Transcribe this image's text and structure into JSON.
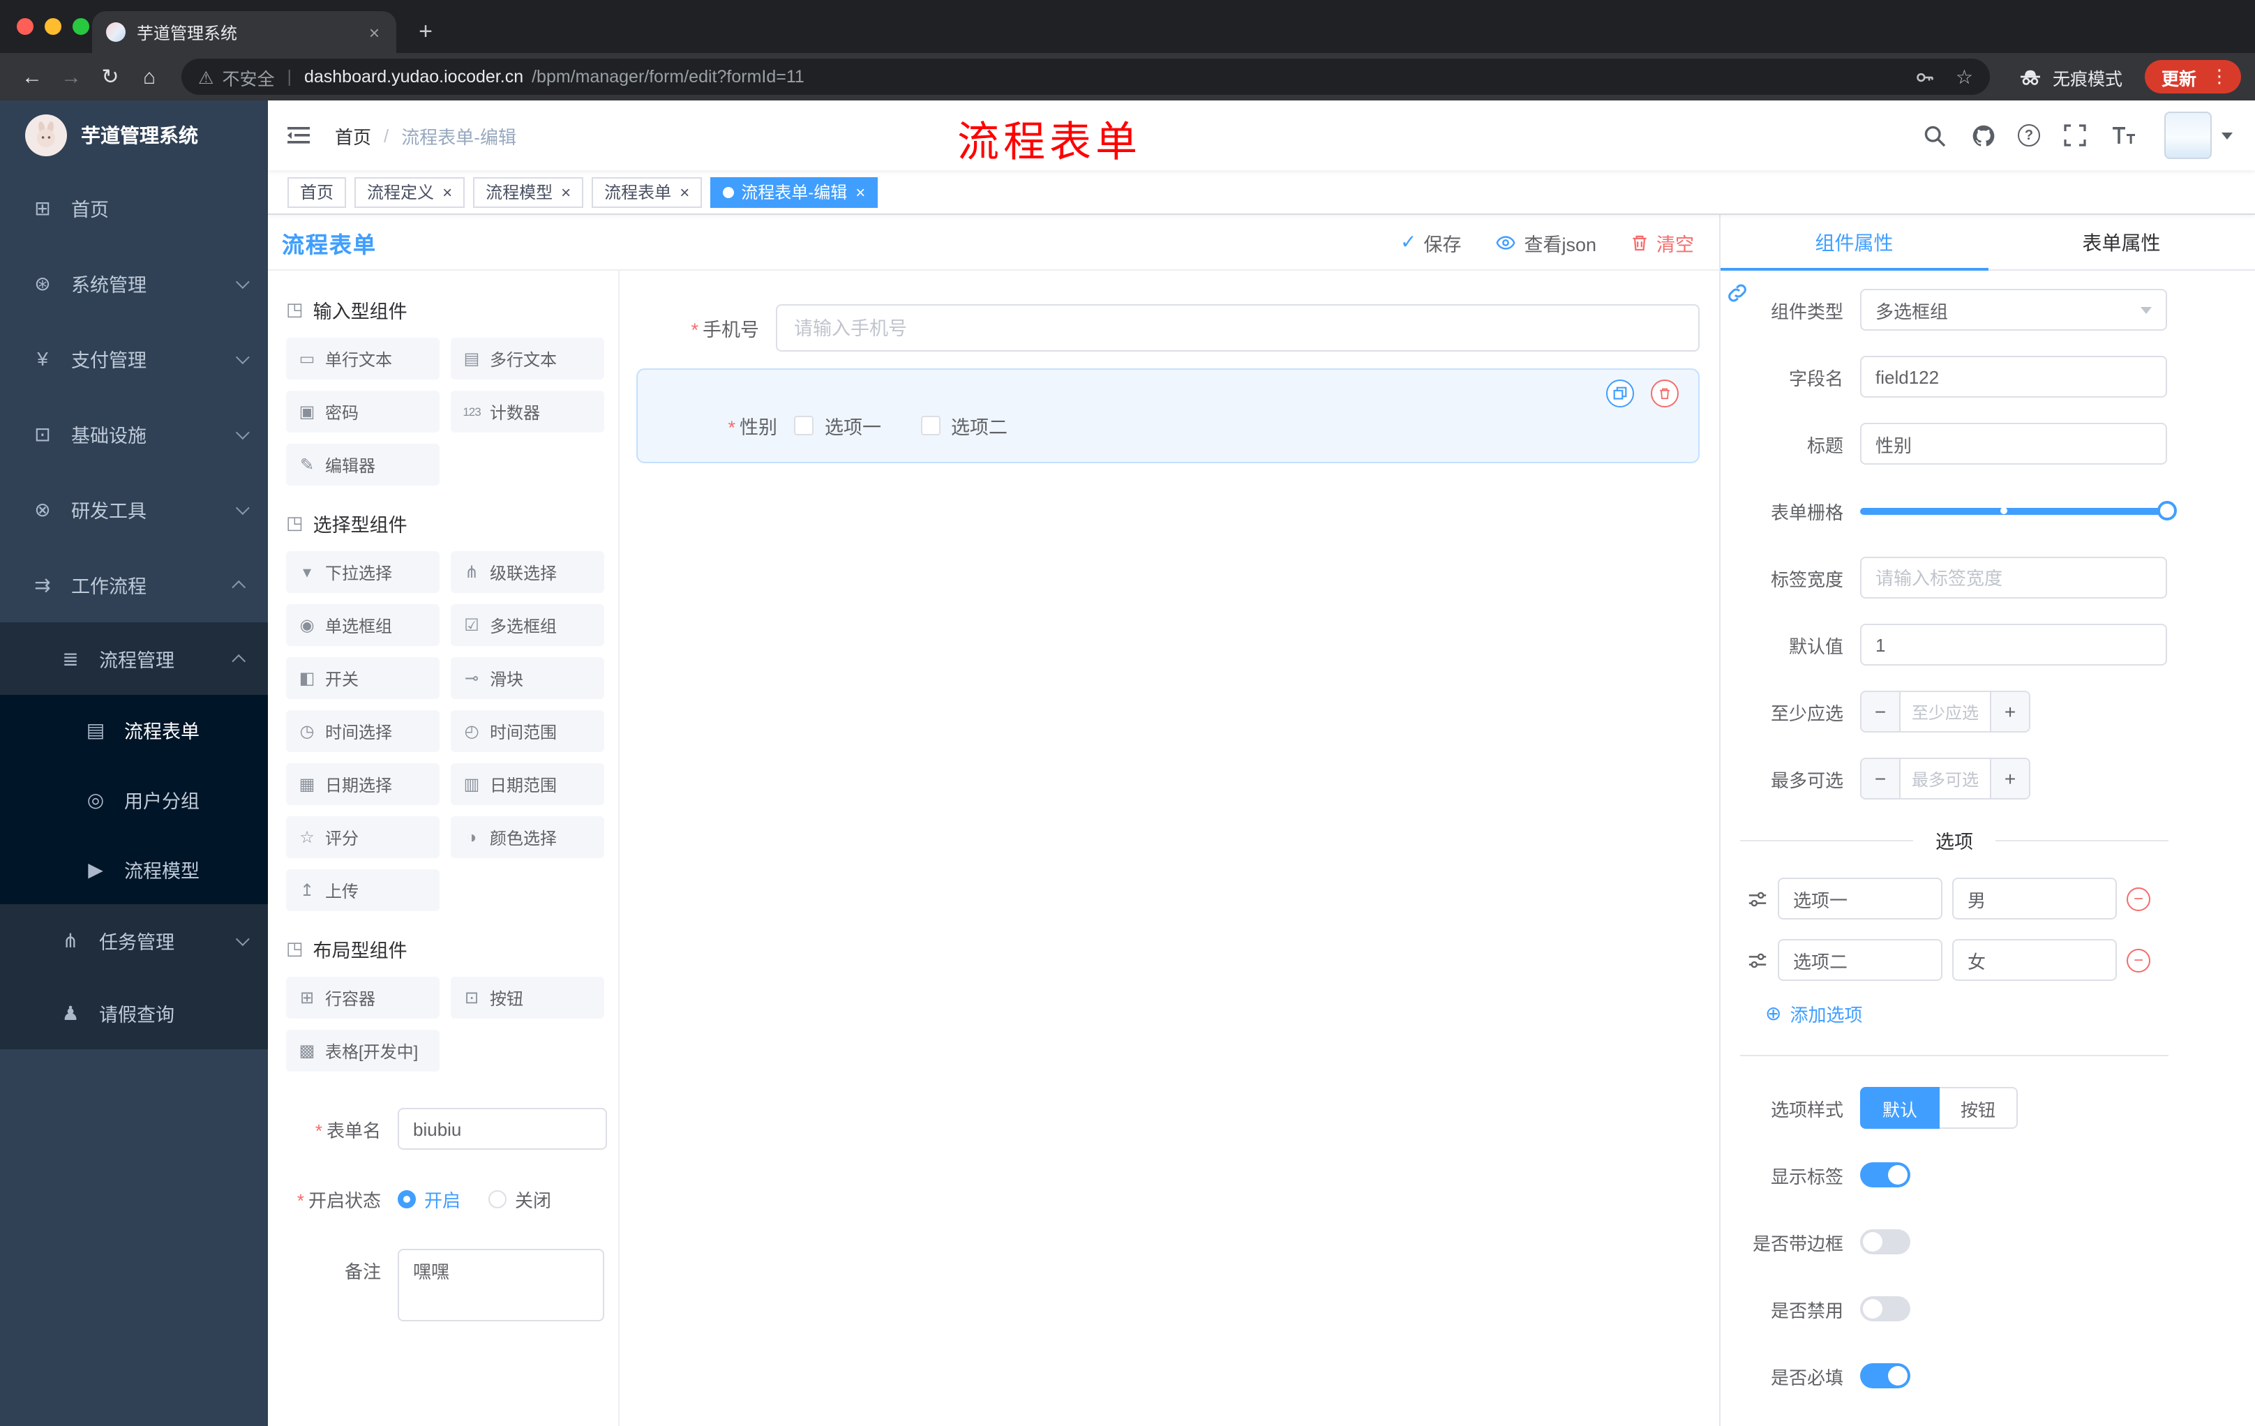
{
  "colors": {
    "accent": "#409eff",
    "danger": "#f56c6c",
    "annotation": "#ff0000",
    "sidebar_bg": "#304156",
    "update_red": "#d93b2b"
  },
  "glyphs": {
    "close": "×",
    "plus": "+",
    "back": "←",
    "forward": "→",
    "reload": "↻",
    "home": "⌂",
    "warning": "⚠",
    "pipe": "|",
    "star": "☆",
    "kebab": "⋮",
    "check": "✓",
    "question": "?",
    "asterisk": "*",
    "circle_plus": "⊕",
    "minus": "−"
  },
  "browser": {
    "tab_title": "芋道管理系统",
    "security_label": "不安全",
    "url_host": "dashboard.yudao.iocoder.cn",
    "url_path": "/bpm/manager/form/edit?formId=11",
    "incognito_label": "无痕模式",
    "update_label": "更新"
  },
  "sidebar": {
    "logo_title": "芋道管理系统",
    "items": [
      {
        "label": "首页",
        "icon": "dashboard-icon",
        "glyph": "⊞"
      },
      {
        "label": "系统管理",
        "icon": "gear-icon",
        "glyph": "⊛"
      },
      {
        "label": "支付管理",
        "icon": "payment-icon",
        "glyph": "¥"
      },
      {
        "label": "基础设施",
        "icon": "infrastructure-icon",
        "glyph": "⊡"
      },
      {
        "label": "研发工具",
        "icon": "devtools-icon",
        "glyph": "⊗"
      },
      {
        "label": "工作流程",
        "icon": "workflow-icon",
        "glyph": "⇉"
      },
      {
        "label": "流程管理",
        "icon": "process-management-icon",
        "glyph": "≣"
      },
      {
        "label": "流程表单",
        "icon": "process-form-icon",
        "glyph": "▤",
        "active": true
      },
      {
        "label": "用户分组",
        "icon": "user-group-icon",
        "glyph": "◎"
      },
      {
        "label": "流程模型",
        "icon": "process-model-icon",
        "glyph": "▶"
      },
      {
        "label": "任务管理",
        "icon": "task-management-icon",
        "glyph": "⋔"
      },
      {
        "label": "请假查询",
        "icon": "leave-query-icon",
        "glyph": "♟"
      }
    ]
  },
  "header": {
    "breadcrumb": {
      "home": "首页",
      "separator": "/",
      "current": "流程表单-编辑"
    },
    "annotation": "流程表单"
  },
  "tags": [
    {
      "label": "首页",
      "closable": false,
      "active": false
    },
    {
      "label": "流程定义",
      "closable": true,
      "active": false
    },
    {
      "label": "流程模型",
      "closable": true,
      "active": false
    },
    {
      "label": "流程表单",
      "closable": true,
      "active": false
    },
    {
      "label": "流程表单-编辑",
      "closable": true,
      "active": true
    }
  ],
  "designer": {
    "title": "流程表单",
    "toolbar": {
      "save": "保存",
      "view_json": "查看json",
      "clear": "清空"
    },
    "palette_groups": [
      {
        "title": "输入型组件",
        "icon_glyph": "◳",
        "items": [
          {
            "label": "单行文本",
            "glyph": "▭"
          },
          {
            "label": "多行文本",
            "glyph": "▤"
          },
          {
            "label": "密码",
            "glyph": "▣"
          },
          {
            "label": "计数器",
            "glyph": "123"
          },
          {
            "label": "编辑器",
            "glyph": "✎"
          }
        ]
      },
      {
        "title": "选择型组件",
        "icon_glyph": "◳",
        "items": [
          {
            "label": "下拉选择",
            "glyph": "▾"
          },
          {
            "label": "级联选择",
            "glyph": "⋔"
          },
          {
            "label": "单选框组",
            "glyph": "◉"
          },
          {
            "label": "多选框组",
            "glyph": "☑"
          },
          {
            "label": "开关",
            "glyph": "◧"
          },
          {
            "label": "滑块",
            "glyph": "⊸"
          },
          {
            "label": "时间选择",
            "glyph": "◷"
          },
          {
            "label": "时间范围",
            "glyph": "◴"
          },
          {
            "label": "日期选择",
            "glyph": "▦"
          },
          {
            "label": "日期范围",
            "glyph": "▥"
          },
          {
            "label": "评分",
            "glyph": "☆"
          },
          {
            "label": "颜色选择",
            "glyph": "◑"
          },
          {
            "label": "上传",
            "glyph": "↥"
          }
        ]
      },
      {
        "title": "布局型组件",
        "icon_glyph": "◳",
        "items": [
          {
            "label": "行容器",
            "glyph": "⊞"
          },
          {
            "label": "按钮",
            "glyph": "⊡"
          },
          {
            "label": "表格[开发中]",
            "glyph": "▩"
          }
        ]
      }
    ],
    "form_meta": {
      "name_label": "表单名",
      "name_value": "biubiu",
      "status_label": "开启状态",
      "status_on": "开启",
      "status_off": "关闭",
      "remark_label": "备注",
      "remark_value": "嘿嘿"
    },
    "canvas": {
      "phone_label": "手机号",
      "phone_placeholder": "请输入手机号",
      "gender_label": "性别",
      "gender_options": [
        "选项一",
        "选项二"
      ]
    }
  },
  "properties": {
    "tab_component": "组件属性",
    "tab_form": "表单属性",
    "component_type_label": "组件类型",
    "component_type_value": "多选框组",
    "field_name_label": "字段名",
    "field_name_value": "field122",
    "title_label": "标题",
    "title_value": "性别",
    "grid_label": "表单栅格",
    "label_width_label": "标签宽度",
    "label_width_placeholder": "请输入标签宽度",
    "default_label": "默认值",
    "default_value": "1",
    "min_label": "至少应选",
    "min_placeholder": "至少应选",
    "max_label": "最多可选",
    "max_placeholder": "最多可选",
    "options_title": "选项",
    "option_rows": [
      {
        "label": "选项一",
        "value": "男"
      },
      {
        "label": "选项二",
        "value": "女"
      }
    ],
    "add_option_label": "添加选项",
    "option_style_label": "选项样式",
    "style_default": "默认",
    "style_button": "按钮",
    "toggle_show_label": "显示标签",
    "toggle_border_label": "是否带边框",
    "toggle_disabled_label": "是否禁用",
    "toggle_required_label": "是否必填"
  }
}
